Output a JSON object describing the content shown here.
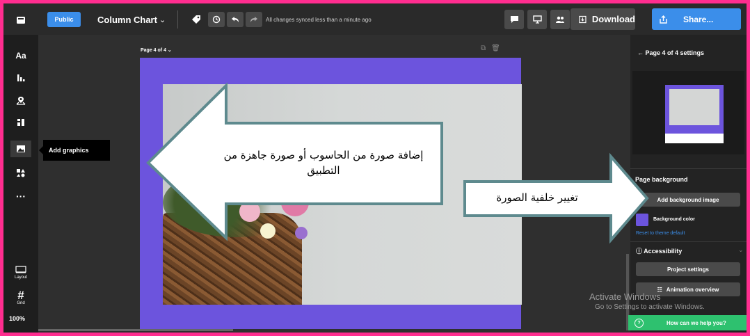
{
  "topbar": {
    "public_label": "Public",
    "chart_title": "Column Chart",
    "chevron": "⌄",
    "sync_status": "All changes synced less than a minute ago",
    "download_label": "Download",
    "share_label": "Share...",
    "icons": [
      "tag-icon",
      "history-icon",
      "undo-icon",
      "redo-icon",
      "comment-icon",
      "present-icon",
      "collaborators-icon"
    ]
  },
  "leftrail": {
    "items": [
      {
        "name": "text-icon",
        "glyph": "Aa"
      },
      {
        "name": "chart-icon",
        "glyph": "▮▮"
      },
      {
        "name": "map-icon",
        "glyph": "◎"
      },
      {
        "name": "layout-blocks-icon",
        "glyph": "▦"
      },
      {
        "name": "image-icon",
        "glyph": "▣"
      },
      {
        "name": "shapes-icon",
        "glyph": "▲●"
      },
      {
        "name": "more-icon",
        "glyph": "···"
      }
    ],
    "layout_label": "Layout",
    "grid_label": "Grid",
    "grid_glyph": "#",
    "zoom": "100%",
    "tooltip": "Add graphics"
  },
  "canvas": {
    "page_label": "Page 4 of 4 ⌄"
  },
  "rpanel": {
    "title": "← Page 4 of 4 settings",
    "page_background_label": "Page background",
    "add_bg_image": "Add background image",
    "bg_color_label": "Background color",
    "reset_label": "Reset to theme default",
    "accessibility_label": "Accessibility",
    "project_settings": "Project settings",
    "animation_overview": "Animation overview",
    "help": "How can we help you?",
    "accent_color": "#6c54dd"
  },
  "windows": {
    "activate_title": "Activate Windows",
    "activate_sub": "Go to Settings to activate Windows."
  },
  "callouts": {
    "left_arrow_text": "إضافة صورة من الحاسوب أو صورة جاهزة من التطبيق",
    "right_arrow_text": "تغيير خلفية الصورة"
  },
  "colors": {
    "frame_border": "#ff2d8f",
    "brand_blue": "#3b8eea",
    "help_green": "#2ec16f"
  }
}
